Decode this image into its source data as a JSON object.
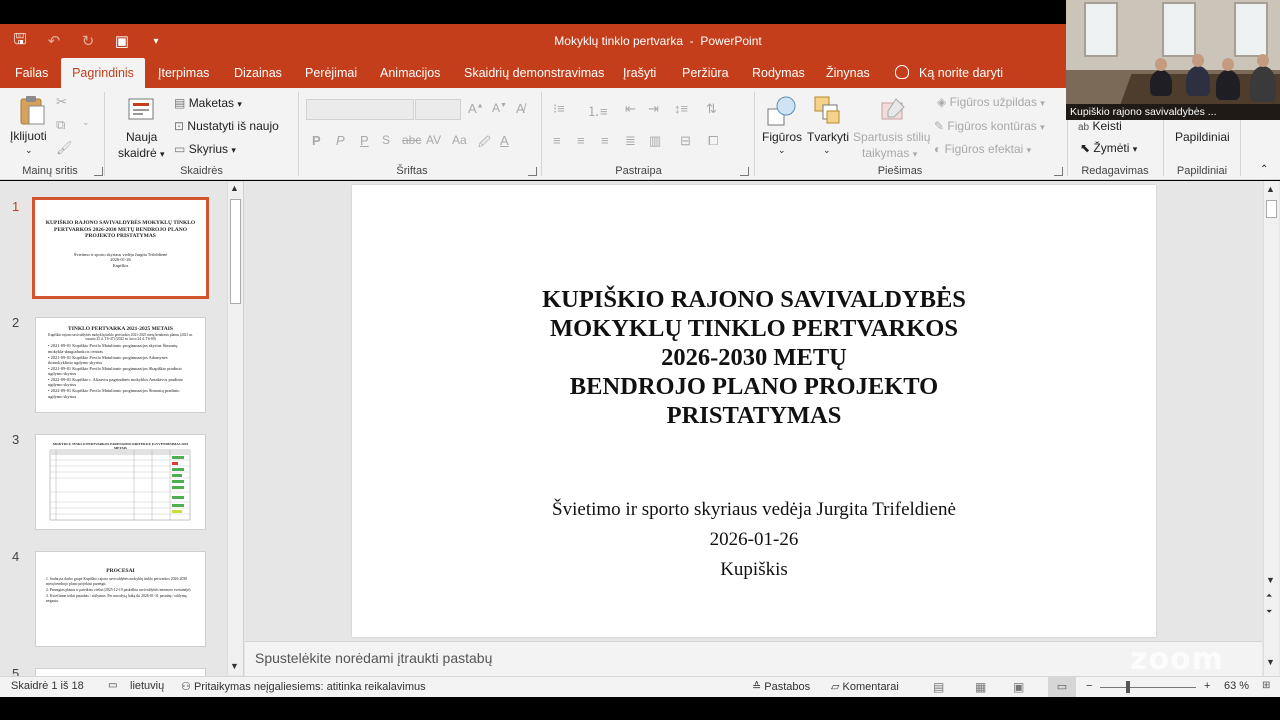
{
  "window": {
    "doc_title": "Mokyklų tinklo pertvarka",
    "separator": "-",
    "app_name": "PowerPoint"
  },
  "tabs": [
    "Failas",
    "Pagrindinis",
    "Įterpimas",
    "Dizainas",
    "Perėjimai",
    "Animacijos",
    "Skaidrių demonstravimas",
    "Įrašyti",
    "Peržiūra",
    "Rodymas",
    "Žinynas"
  ],
  "tell_me": "Ką norite daryti",
  "ribbon": {
    "paste": "Įklijuoti",
    "clipboard_group": "Mainų sritis",
    "new_slide_1": "Nauja",
    "new_slide_2": "skaidrė",
    "layout": "Maketas",
    "reset": "Nustatyti iš naujo",
    "sections": "Skyrius",
    "slides_group": "Skaidrės",
    "font_group": "Šriftas",
    "paragraph_group": "Pastraipa",
    "shapes": "Figūros",
    "arrange": "Tvarkyti",
    "quick_styles_1": "Spartusis stilių",
    "quick_styles_2": "taikymas",
    "shape_fill": "Figūros užpildas",
    "shape_outline": "Figūros kontūras",
    "shape_effects": "Figūros efektai",
    "drawing_group": "Piešimas",
    "replace": "Keisti",
    "select": "Žymėti",
    "editing_group": "Redagavimas",
    "addins": "Papildiniai",
    "addins_group": "Papildiniai"
  },
  "webcam": {
    "caption": "Kupiškio rajono savivaldybės ..."
  },
  "thumbnails": [
    {
      "num": "1",
      "title": "KUPIŠKIO RAJONO SAVIVALDYBĖS MOKYKLŲ TINKLO PERTVARKOS 2026-2030 METŲ BENDROJO PLANO PROJEKTO PRISTATYMAS",
      "l1": "Švietimo ir sporto skyriaus vedėja Jurgita Trifeldienė",
      "l2": "2026-01-26",
      "l3": "Kupiškis"
    },
    {
      "num": "2",
      "title": "TINKLO PERTVARKA 2021-2025 METAIS",
      "sub": "Kupiškio rajono savivaldybės mokyklų tinklo pertvarkos 2021-2025 metų bendrasis planas (2021 m. vasario 25 d. TS-47) (2022 m. kovo 24 d. TS-69)",
      "b1": "2021-09-01 Kupiškio Povilo Matulionio progimnazijos skyrius Šimonių mokykla-daugiafunkcis centras",
      "b2": "2021-09-01 Kupiškio Povilo Matulionio progimnazijos Adomynės ikimokyklinio ugdymo skyrius",
      "b3": "2021-09-01 Kupiškio Povilo Matulionio progimnazijos Skapiškio pradinio ugdymo skyrius",
      "b4": "2022-09-01 Kupiškio r. Alizavos pagrindinės mokyklos Antašavos pradinio ugdymo skyrius",
      "b5": "2022-09-01 Kupiškio Povilo Matulionio progimnazijos Šimonių pradinio ugdymo skyrius"
    },
    {
      "num": "3",
      "title": "MOKYKLŲ TINKLO PERTVARKOS PARENGIMO KRITERIJŲ ĮGYVENDINIMAS 2025 METAIS"
    },
    {
      "num": "4",
      "title": "PROCESAI",
      "b1": "Sudaryta darbo grupė Kupiškio rajono savivaldybės mokyklų tinklo pertvarkos 2026-2030 metų bendrojo plano projektui parengti.",
      "b2": "Parengtas planas ir pateiktas viešai (2025-12-19 paskelbta savivaldybės interneto svetainėje).",
      "b3": "Kviečiame teikti pastabas / siūlymus. Per nurodytą laiką iki 2026-01-31 pastabų / siūlymų negauta."
    },
    {
      "num": "5"
    }
  ],
  "slide": {
    "title_1": "KUPIŠKIO RAJONO SAVIVALDYBĖS",
    "title_2": "MOKYKLŲ TINKLO PERTVARKOS",
    "title_3": "2026-2030 METŲ",
    "title_4": "BENDROJO PLANO PROJEKTO",
    "title_5": "PRISTATYMAS",
    "presenter": "Švietimo ir sporto skyriaus vedėja Jurgita Trifeldienė",
    "date": "2026-01-26",
    "place": "Kupiškis"
  },
  "notes_placeholder": "Spustelėkite norėdami įtraukti pastabų",
  "watermark": "zoom",
  "status": {
    "slide_info": "Skaidrė 1 iš 18",
    "language": "lietuvių",
    "accessibility": "Pritaikymas neįgaliesiems: atitinka reikalavimus",
    "notes": "Pastabos",
    "comments": "Komentarai",
    "zoom_minus": "−",
    "zoom_plus": "+",
    "zoom_level": "63 %"
  },
  "colors": {
    "accent": "#c43e1c",
    "active_thumb_border": "#d35230",
    "ribbon_bg": "#f3f3f3",
    "canvas_bg": "#e6e6e6"
  }
}
